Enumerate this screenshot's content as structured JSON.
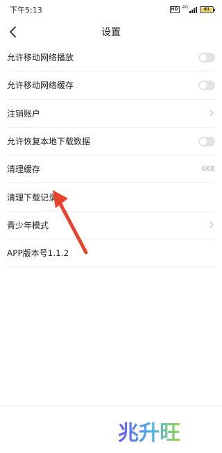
{
  "status_bar": {
    "time": "下午5:13",
    "hd_badge": "HD",
    "network_label": "4G",
    "battery_level": "81",
    "battery_color": "#f2d34c"
  },
  "nav": {
    "back_icon": "chevron-left-icon",
    "title": "设置"
  },
  "settings": {
    "items": [
      {
        "label": "允许移动网络播放",
        "control": "toggle",
        "checked": false
      },
      {
        "label": "允许移动网络缓存",
        "control": "toggle",
        "checked": false
      },
      {
        "label": "注销账户",
        "control": "chevron-right-icon"
      },
      {
        "label": "允许恢复本地下载数据",
        "control": "toggle",
        "checked": false
      },
      {
        "label": "清理缓存",
        "control": "value",
        "value": "0KB"
      },
      {
        "label": "清理下载记录",
        "control": "none"
      },
      {
        "label": "青少年模式",
        "control": "chevron-right-icon"
      },
      {
        "label": "APP版本号1.1.2",
        "control": "none"
      }
    ]
  },
  "annotation": {
    "arrow_color": "#e8412c"
  },
  "watermark": {
    "text": "兆升旺",
    "colors": [
      "#6b5cf0",
      "#4fb3e8",
      "#9ad34a"
    ]
  }
}
